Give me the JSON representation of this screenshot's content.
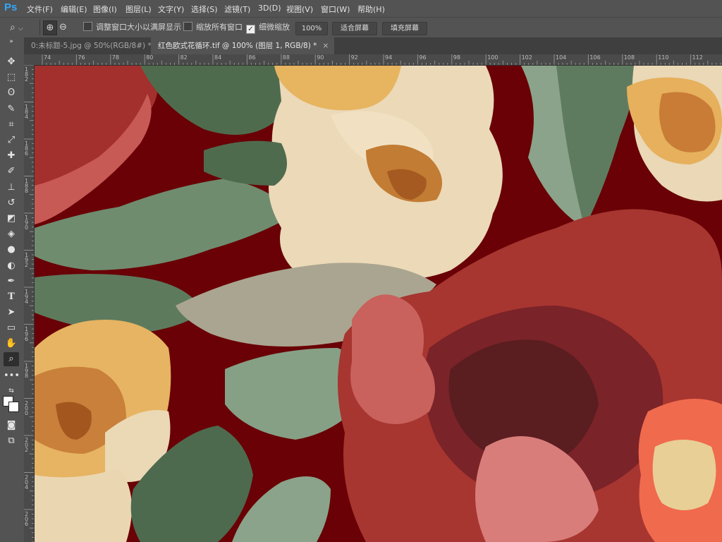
{
  "app": {
    "logo": "Ps",
    "menus": [
      "文件(F)",
      "编辑(E)",
      "图像(I)",
      "图层(L)",
      "文字(Y)",
      "选择(S)",
      "滤镜(T)",
      "3D(D)",
      "视图(V)",
      "窗口(W)",
      "帮助(H)"
    ]
  },
  "options": {
    "fit_windows_label": "调整窗口大小以满屏显示",
    "fit_windows_checked": false,
    "zoom_all_label": "缩放所有窗口",
    "zoom_all_checked": false,
    "scrubby_label": "细微缩放",
    "scrubby_checked": true,
    "zoom_value": "100%",
    "fit_screen_label": "适合屏幕",
    "fill_screen_label": "填充屏幕"
  },
  "tabs": [
    {
      "title": "0:未标题-5.jpg @ 50%(RGB/8#) *",
      "close": "×",
      "active": false
    },
    {
      "title": "红色欧式花循环.tif @ 100% (图层 1, RGB/8) *",
      "close": "×",
      "active": true
    }
  ],
  "ruler": {
    "top": [
      "74",
      "76",
      "78",
      "80",
      "82",
      "84",
      "86",
      "88",
      "90",
      "92",
      "94",
      "96",
      "98",
      "100",
      "102",
      "104",
      "106",
      "108",
      "110",
      "112"
    ],
    "left": [
      "182",
      "184",
      "186",
      "188",
      "190",
      "192",
      "194",
      "196",
      "198",
      "200",
      "202",
      "204",
      "206"
    ]
  },
  "tools": [
    "move-icon",
    "marquee-icon",
    "lasso-icon",
    "quick-select-icon",
    "crop-icon",
    "eyedropper-icon",
    "healing-icon",
    "brush-icon",
    "stamp-icon",
    "history-brush-icon",
    "eraser-icon",
    "paint-bucket-icon",
    "blur-icon",
    "dodge-icon",
    "pen-icon",
    "type-icon",
    "path-select-icon",
    "shape-icon",
    "hand-icon",
    "zoom-icon",
    "more-icon"
  ],
  "colors": {
    "ui_bg": "#535353",
    "canvas_bg": "#690106",
    "accent": "#31a8ff"
  }
}
